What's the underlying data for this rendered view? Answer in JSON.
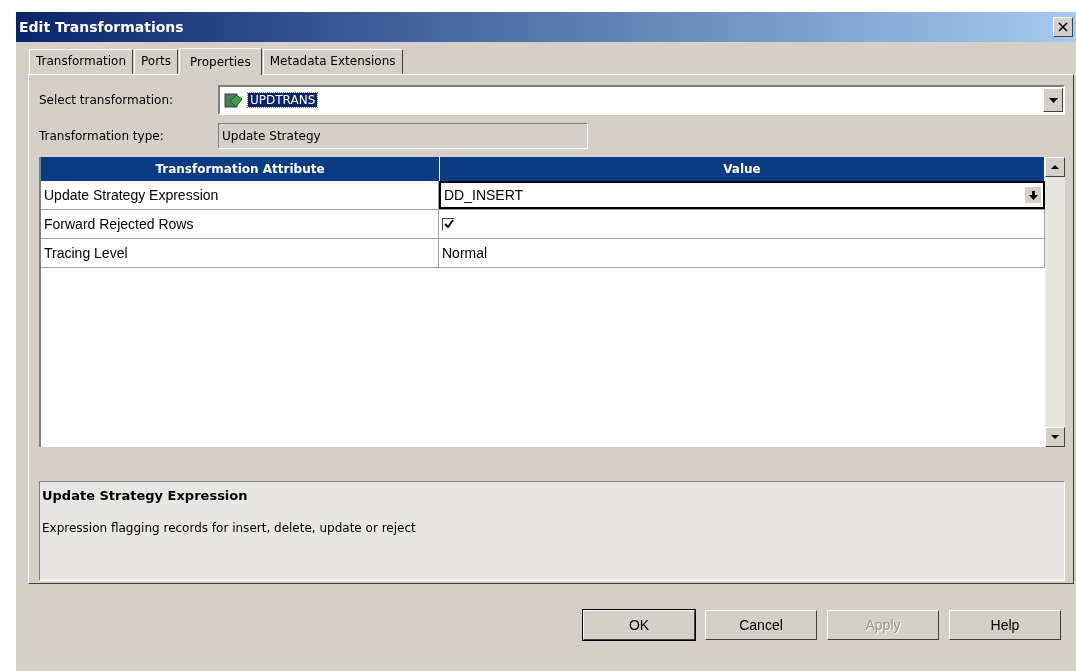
{
  "window": {
    "title": "Edit Transformations"
  },
  "tabs": [
    {
      "label": "Transformation",
      "selected": false
    },
    {
      "label": "Ports",
      "selected": false
    },
    {
      "label": "Properties",
      "selected": true
    },
    {
      "label": "Metadata Extensions",
      "selected": false
    }
  ],
  "select_transformation": {
    "label": "Select transformation:",
    "value": "UPDTRANS"
  },
  "transformation_type": {
    "label": "Transformation type:",
    "value": "Update Strategy"
  },
  "table": {
    "columns": [
      "Transformation Attribute",
      "Value"
    ],
    "rows": [
      {
        "attribute": "Update Strategy Expression",
        "kind": "dropdown",
        "value": "DD_INSERT",
        "selected": true
      },
      {
        "attribute": "Forward Rejected Rows",
        "kind": "checkbox",
        "checked": true,
        "selected": false
      },
      {
        "attribute": "Tracing Level",
        "kind": "text",
        "value": "Normal",
        "selected": false
      }
    ]
  },
  "description": {
    "title": "Update Strategy Expression",
    "text": "Expression flagging records for insert, delete, update or reject"
  },
  "buttons": [
    {
      "label": "OK",
      "default": true,
      "disabled": false
    },
    {
      "label": "Cancel",
      "default": false,
      "disabled": false
    },
    {
      "label": "Apply",
      "default": false,
      "disabled": true
    },
    {
      "label": "Help",
      "default": false,
      "disabled": false
    }
  ]
}
